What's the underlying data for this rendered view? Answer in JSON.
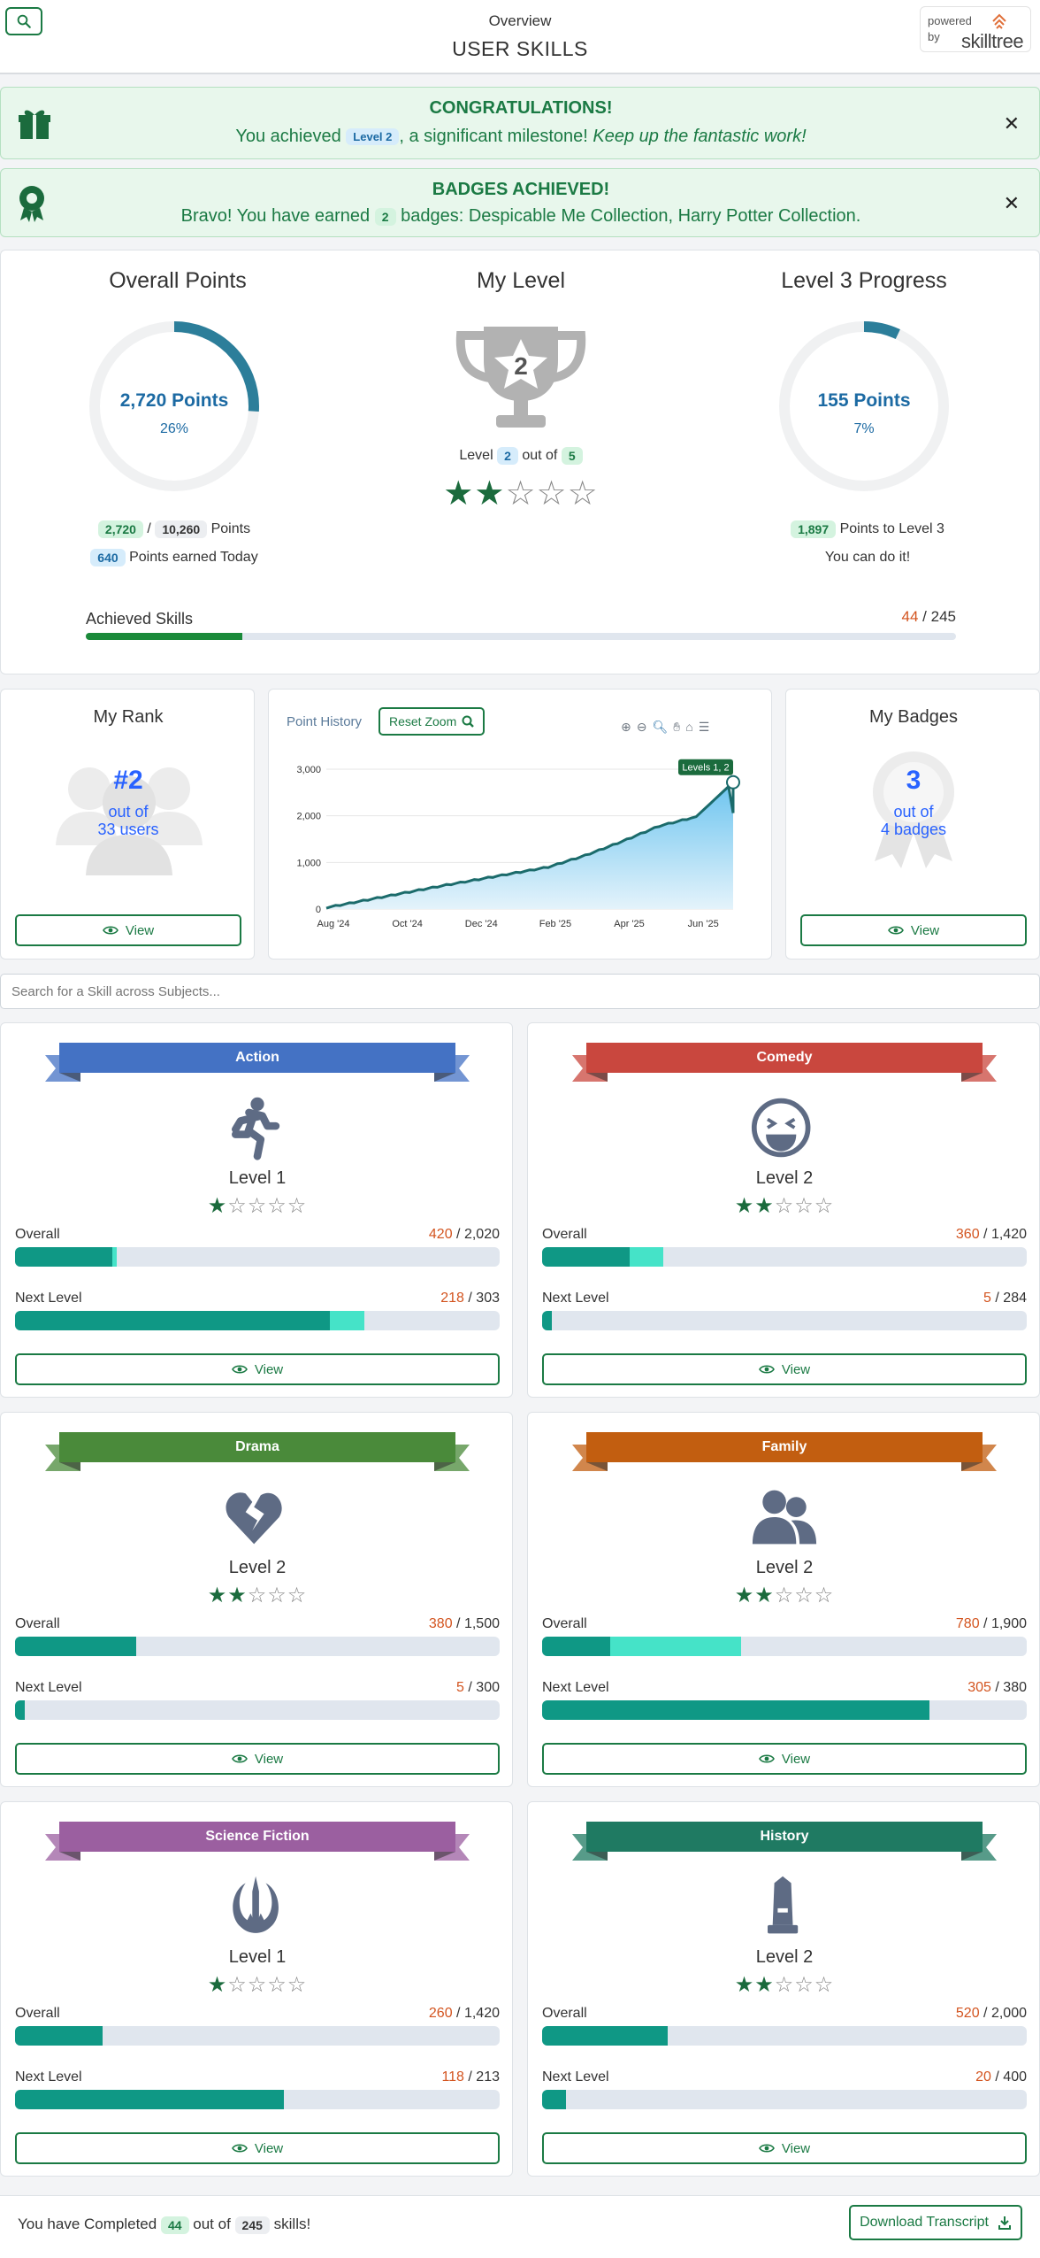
{
  "header": {
    "overview": "Overview",
    "title": "USER SKILLS",
    "powered_by": "powered",
    "powered_by2": "by",
    "brand": "skilltree"
  },
  "alerts": {
    "congrats": {
      "heading": "CONGRATULATIONS!",
      "pre": "You achieved",
      "level_badge": "Level 2",
      "mid": ", a significant milestone!",
      "emph": "Keep up the fantastic work!"
    },
    "badges": {
      "heading": "BADGES ACHIEVED!",
      "pre": "Bravo! You have earned",
      "count": "2",
      "post": "badges: Despicable Me Collection, Harry Potter Collection."
    }
  },
  "summary": {
    "overall": {
      "title": "Overall Points",
      "ring_value": "2,720 Points",
      "ring_pct": "26%",
      "progress": 0.26,
      "earned": "2,720",
      "slash": "/",
      "total": "10,260",
      "points_word": "Points",
      "today": "640",
      "today_label": "Points earned Today"
    },
    "level": {
      "title": "My Level",
      "trophy_num": "2",
      "level_word": "Level",
      "level": "2",
      "out_of": "out of",
      "max": "5",
      "stars_filled": 2,
      "stars_total": 5
    },
    "progress": {
      "title": "Level 3 Progress",
      "ring_value": "155 Points",
      "ring_pct": "7%",
      "progress": 0.07,
      "remaining": "1,897",
      "remaining_label": "Points to Level 3",
      "encourage": "You can do it!"
    },
    "achieved": {
      "label": "Achieved Skills",
      "done": "44",
      "total": "245",
      "progress": 0.18
    }
  },
  "rank": {
    "title": "My Rank",
    "rank": "#2",
    "out_of": "out of",
    "users": "33 users",
    "view": "View"
  },
  "history": {
    "title": "Point History",
    "reset": "Reset Zoom",
    "tooltip": "Levels 1, 2"
  },
  "badges_card": {
    "title": "My Badges",
    "count": "3",
    "out_of": "out of",
    "total": "4 badges",
    "view": "View"
  },
  "chart_data": {
    "type": "area",
    "title": "Point History",
    "x": [
      "Aug '24",
      "Sep '24",
      "Oct '24",
      "Nov '24",
      "Dec '24",
      "Jan '25",
      "Feb '25",
      "Mar '25",
      "Apr '25",
      "May '25",
      "Jun '25",
      "Jul '25"
    ],
    "series": [
      {
        "values": [
          30,
          180,
          330,
          480,
          620,
          760,
          900,
          1150,
          1450,
          1780,
          1980,
          2720
        ]
      }
    ],
    "x_ticks": [
      "Aug '24",
      "Oct '24",
      "Dec '24",
      "Feb '25",
      "Apr '25",
      "Jun '25"
    ],
    "y_ticks": [
      "0",
      "1,000",
      "2,000",
      "3,000"
    ],
    "ylim": [
      0,
      3000
    ],
    "grid": true,
    "accent": "#1b6b6b"
  },
  "search": {
    "placeholder": "Search for a Skill across Subjects..."
  },
  "subjects": [
    {
      "name": "Action",
      "color": "#4472c4",
      "icon": "running-icon",
      "level": "Level 1",
      "stars": 1,
      "overall_label": "Overall",
      "overall_pts": "420",
      "overall_total": "2,020",
      "overall": 0.2,
      "overall_today": 0.01,
      "next_label": "Next Level",
      "next_pts": "218",
      "next_total": "303",
      "next": 0.65,
      "next_today": 0.07
    },
    {
      "name": "Comedy",
      "color": "#c9473e",
      "icon": "laugh-icon",
      "level": "Level 2",
      "stars": 2,
      "overall_label": "Overall",
      "overall_pts": "360",
      "overall_total": "1,420",
      "overall": 0.18,
      "overall_today": 0.07,
      "next_label": "Next Level",
      "next_pts": "5",
      "next_total": "284",
      "next": 0.02,
      "next_today": 0
    },
    {
      "name": "Drama",
      "color": "#4a8a3a",
      "icon": "broken-heart-icon",
      "level": "Level 2",
      "stars": 2,
      "overall_label": "Overall",
      "overall_pts": "380",
      "overall_total": "1,500",
      "overall": 0.25,
      "overall_today": 0,
      "next_label": "Next Level",
      "next_pts": "5",
      "next_total": "300",
      "next": 0.02,
      "next_today": 0
    },
    {
      "name": "Family",
      "color": "#c25e10",
      "icon": "users-icon",
      "level": "Level 2",
      "stars": 2,
      "overall_label": "Overall",
      "overall_pts": "780",
      "overall_total": "1,900",
      "overall": 0.14,
      "overall_today": 0.27,
      "next_label": "Next Level",
      "next_pts": "305",
      "next_total": "380",
      "next": 0.8,
      "next_today": 0
    },
    {
      "name": "Science Fiction",
      "color": "#9b5fa0",
      "icon": "jedi-icon",
      "level": "Level 1",
      "stars": 1,
      "overall_label": "Overall",
      "overall_pts": "260",
      "overall_total": "1,420",
      "overall": 0.18,
      "overall_today": 0,
      "next_label": "Next Level",
      "next_pts": "118",
      "next_total": "213",
      "next": 0.555,
      "next_today": 0
    },
    {
      "name": "History",
      "color": "#1f7a62",
      "icon": "monument-icon",
      "level": "Level 2",
      "stars": 2,
      "overall_label": "Overall",
      "overall_pts": "520",
      "overall_total": "2,000",
      "overall": 0.26,
      "overall_today": 0,
      "next_label": "Next Level",
      "next_pts": "20",
      "next_total": "400",
      "next": 0.05,
      "next_today": 0
    }
  ],
  "footer": {
    "pre": "You have Completed",
    "done": "44",
    "out_of": "out of",
    "total": "245",
    "post": "skills!",
    "download": "Download Transcript"
  }
}
